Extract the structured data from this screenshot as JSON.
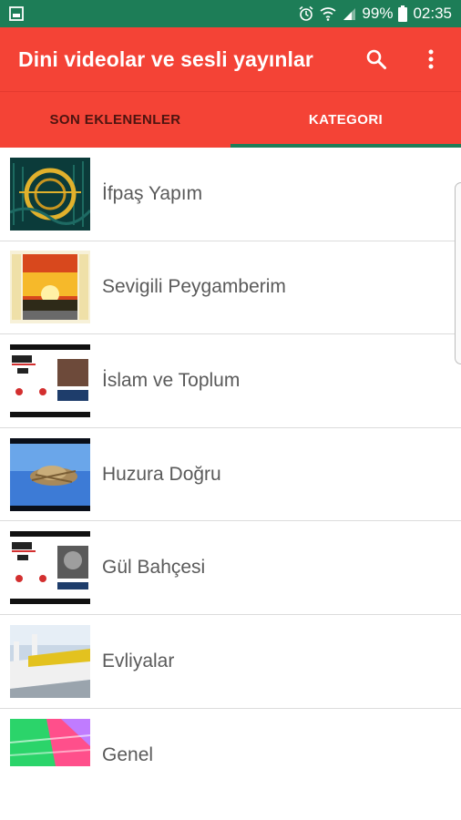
{
  "status": {
    "battery": "99%",
    "time": "02:35"
  },
  "app": {
    "title": "Dini videolar ve sesli yayınlar"
  },
  "tabs": [
    {
      "label": "SON EKLENENLER",
      "active": false
    },
    {
      "label": "KATEGORI",
      "active": true
    }
  ],
  "colors": {
    "primary": "#f44336",
    "status_bar": "#1d7d57",
    "indicator": "#1d7d57"
  },
  "categories": [
    {
      "label": "İfpaş Yapım"
    },
    {
      "label": "Sevigili Peygamberim"
    },
    {
      "label": "İslam ve Toplum"
    },
    {
      "label": "Huzura Doğru"
    },
    {
      "label": "Gül Bahçesi"
    },
    {
      "label": "Evliyalar"
    },
    {
      "label": "Genel"
    }
  ]
}
